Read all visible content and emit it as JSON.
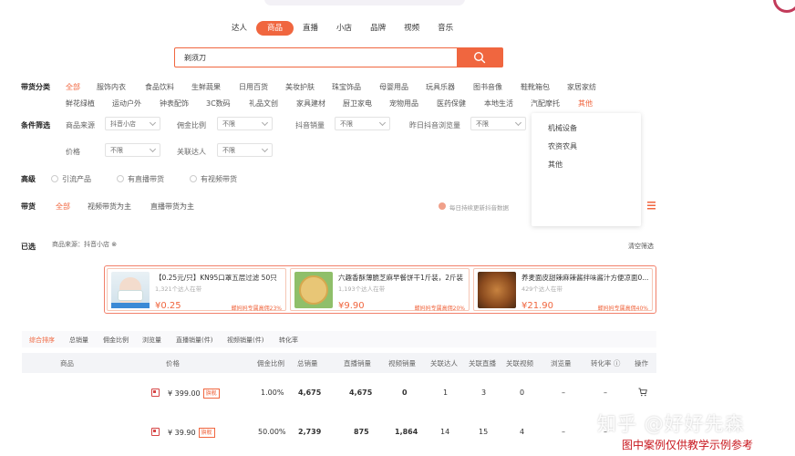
{
  "tabs": [
    "达人",
    "商品",
    "直播",
    "小店",
    "品牌",
    "视频",
    "音乐"
  ],
  "active_tab": "商品",
  "search": {
    "value": "剃须刀"
  },
  "category": {
    "label": "带货分类",
    "row1": [
      "全部",
      "服饰内衣",
      "食品饮料",
      "生鲜蔬果",
      "日用百货",
      "美妆护肤",
      "珠宝饰品",
      "母婴用品",
      "玩具乐器",
      "图书音像",
      "鞋靴箱包",
      "家居家纺"
    ],
    "row2": [
      "鲜花绿植",
      "运动户外",
      "钟表配饰",
      "3C数码",
      "礼品文创",
      "家具建材",
      "厨卫家电",
      "宠物用品",
      "医药保健",
      "本地生活",
      "汽配摩托",
      "其他"
    ]
  },
  "conditions": {
    "label": "条件筛选",
    "source_label": "商品来源",
    "source_value": "抖音小店",
    "commission_label": "佣金比例",
    "commission_value": "不限",
    "sales_label": "抖音销量",
    "sales_value": "不限",
    "views_label": "昨日抖音浏览量",
    "views_value": "不限",
    "price_label": "价格",
    "price_value": "不限",
    "talent_label": "关联达人",
    "talent_value": "不限"
  },
  "dropdown_options": [
    "机械设备",
    "农资农具",
    "其他"
  ],
  "advanced": {
    "label": "高级",
    "options": [
      "引流产品",
      "有直播带货",
      "有视频带货"
    ]
  },
  "daihuo": {
    "label": "带货",
    "options": [
      "全部",
      "视频带货为主",
      "直播带货为主"
    ],
    "note": "每日持续更新抖音数据"
  },
  "selected": {
    "label": "已选",
    "tag": "商品来源：抖音小店 ⊗",
    "clear": "清空筛选"
  },
  "banner_cards": [
    {
      "title": "【0.25元/只】KN95口罩五层过滤 50只",
      "sub": "1,321个达人在带",
      "price": "¥0.25",
      "commission": "蝉妈妈专属高佣23%",
      "color": "#d7e6ee"
    },
    {
      "title": "六趣香酥薄脆芝麻早餐饼干1斤装，2斤装",
      "sub": "1,193个达人在带",
      "price": "¥9.90",
      "commission": "蝉妈妈专属高佣20%",
      "color": "#e7cf8a"
    },
    {
      "title": "养麦面皮甜辣麻辣酱拌味酱汁方便凉面0...",
      "sub": "429个达人在带",
      "price": "¥21.90",
      "commission": "蝉妈妈专属高佣40%",
      "color": "#b9733a"
    }
  ],
  "sort_options": [
    "综合排序",
    "总销量",
    "佣金比例",
    "浏览量",
    "直播销量(件)",
    "视频销量(件)",
    "转化率"
  ],
  "table": {
    "headers": [
      "商品",
      "价格",
      "佣金比例",
      "总销量",
      "直播销量",
      "视频销量",
      "关联达人",
      "关联直播",
      "关联视频",
      "浏览量",
      "转化率 ⓘ",
      "操作"
    ],
    "rows": [
      {
        "price": "¥ 399.00",
        "badge": "旗舰",
        "commission": "1.00%",
        "total": "4,675",
        "live": "4,675",
        "video": "0",
        "talent": "1",
        "live_rel": "3",
        "video_rel": "0",
        "views": "–",
        "conv": "–"
      },
      {
        "price": "¥ 39.90",
        "badge": "旗舰",
        "commission": "50.00%",
        "total": "2,739",
        "live": "875",
        "video": "1,864",
        "talent": "14",
        "live_rel": "15",
        "video_rel": "4",
        "views": "–",
        "conv": "–"
      }
    ]
  },
  "watermark": "知乎 @好好先森",
  "footer_note": "图中案例仅供教学示例参考",
  "colors": {
    "accent": "#f0663f",
    "footer": "#c8171e"
  }
}
